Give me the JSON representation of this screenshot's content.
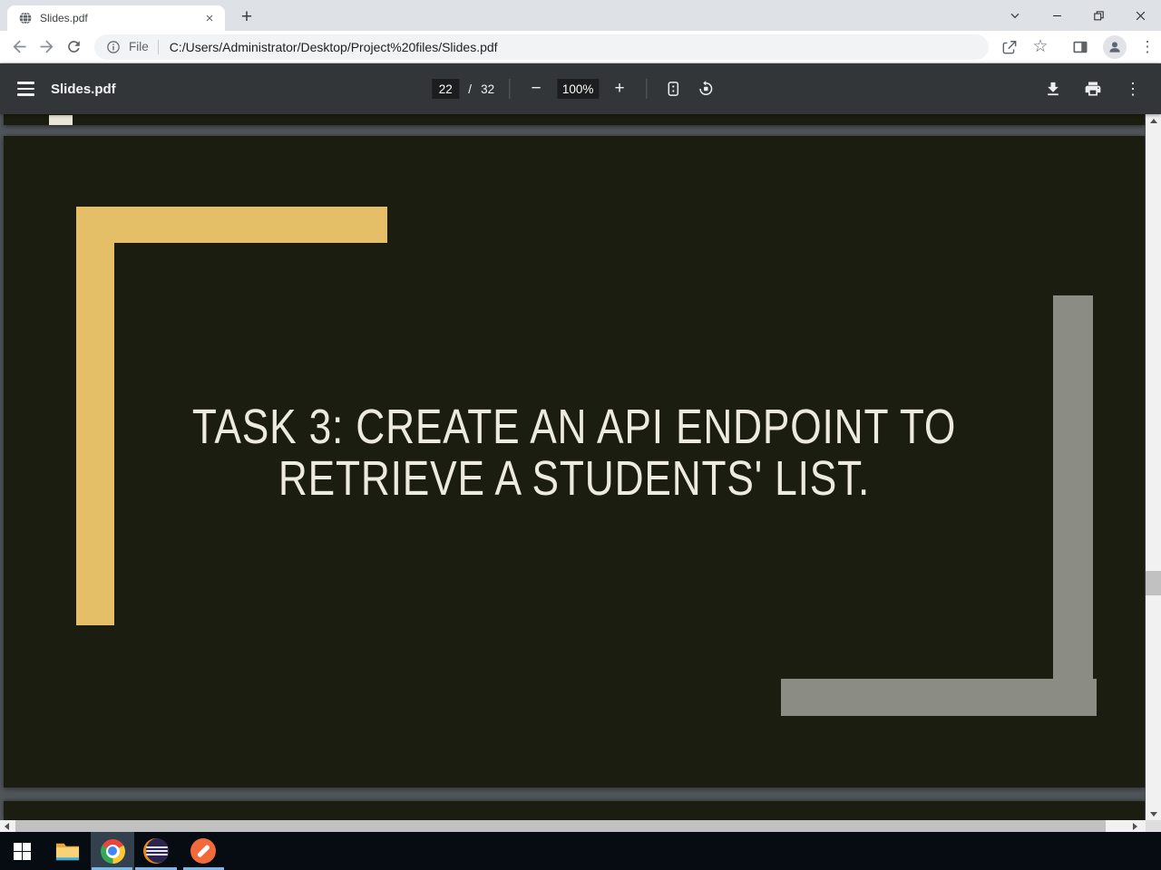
{
  "browser": {
    "tab_title": "Slides.pdf",
    "close_tab_glyph": "×",
    "new_tab_glyph": "+",
    "address": {
      "chip_label": "File",
      "url": "C:/Users/Administrator/Desktop/Project%20files/Slides.pdf"
    }
  },
  "pdf": {
    "filename": "Slides.pdf",
    "page_current": "22",
    "page_separator": "/",
    "page_total": "32",
    "zoom_value": "100%",
    "zoom_out_glyph": "−",
    "zoom_in_glyph": "+"
  },
  "icons": {
    "kebab": "⋮",
    "star": "☆"
  },
  "slide": {
    "title_line1": "TASK 3: CREATE AN API ENDPOINT TO",
    "title_line2": "RETRIEVE A STUDENTS' LIST."
  },
  "colors": {
    "slide_background": "#1C1D11",
    "slide_text": "#EDEBDF",
    "accent_yellow": "#E4BF68",
    "accent_gray": "#8B8C83",
    "pdf_toolbar_bg": "#323639",
    "tab_strip_bg": "#DEE1E6",
    "taskbar_bg": "#070B12",
    "running_indicator": "#7CB8E8"
  },
  "taskbar": {
    "apps": [
      "start",
      "file-explorer",
      "chrome",
      "eclipse",
      "postman"
    ]
  }
}
